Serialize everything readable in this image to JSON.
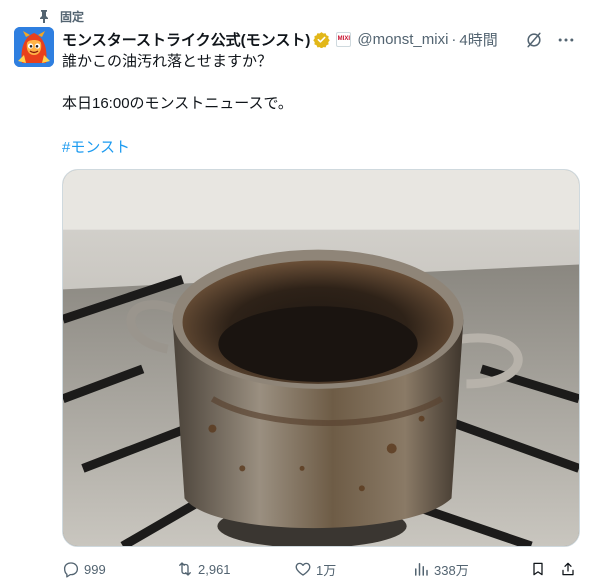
{
  "pinned": {
    "label": "固定"
  },
  "author": {
    "display_name": "モンスターストライク公式(モンスト)",
    "affiliate_badge": "MIXI",
    "handle": "@monst_mixi",
    "separator": "·",
    "time": "4時間"
  },
  "post": {
    "line1": "誰かこの油汚れ落とせますか？",
    "line2": "本日16:00のモンストニュースで。",
    "hashtag": "#モンスト"
  },
  "stats": {
    "replies": "999",
    "reposts": "2,961",
    "likes": "1万",
    "views": "338万"
  },
  "icons": {
    "pin": "pin-icon",
    "verified": "verified-badge-icon",
    "grok": "grok-icon",
    "more": "more-icon",
    "reply": "reply-icon",
    "repost": "repost-icon",
    "like": "heart-icon",
    "views": "views-icon",
    "bookmark": "bookmark-icon",
    "share": "share-icon"
  },
  "colors": {
    "accent": "#1d9bf0",
    "secondary_text": "#536471",
    "verified_gold": "#e2b719"
  }
}
